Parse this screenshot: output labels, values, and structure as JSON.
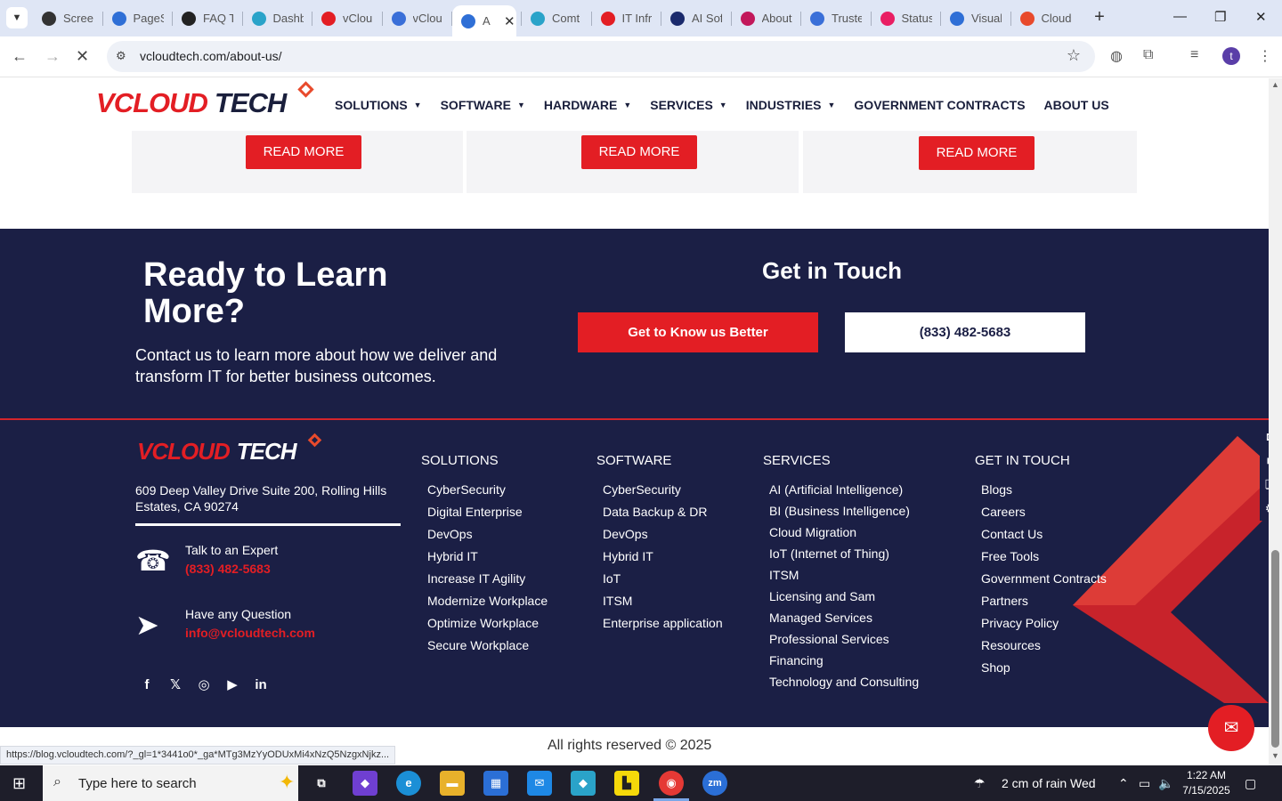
{
  "browser": {
    "tabs": [
      {
        "label": "Scree",
        "color": "#333333"
      },
      {
        "label": "PageS",
        "color": "#2f6fd6"
      },
      {
        "label": "FAQ T",
        "color": "#222222"
      },
      {
        "label": "Dashb",
        "color": "#2aa3c9"
      },
      {
        "label": "vClou",
        "color": "#e31e24"
      },
      {
        "label": "vClou",
        "color": "#3a6fd8"
      },
      {
        "label": "A",
        "color": "#2f6fd6",
        "active": true
      },
      {
        "label": "Comt",
        "color": "#2aa3c9"
      },
      {
        "label": "IT Infr",
        "color": "#e31e24"
      },
      {
        "label": "AI Sof",
        "color": "#1a2a6c"
      },
      {
        "label": "About",
        "color": "#c2185b"
      },
      {
        "label": "Truste",
        "color": "#3a6fd8"
      },
      {
        "label": "Status",
        "color": "#e91e63"
      },
      {
        "label": "Visual",
        "color": "#2f6fd6"
      },
      {
        "label": "Cloud",
        "color": "#e84a2c"
      }
    ],
    "url": "vcloudtech.com/about-us/",
    "profile_initial": "t",
    "status_url": "https://blog.vcloudtech.com/?_gl=1*3441o0*_ga*MTg3MzYyODUxMi4xNzQ5NzgxNjkz..."
  },
  "site": {
    "logo": {
      "v": "V",
      "cloud": "CLOUD",
      "tech": "TECH"
    },
    "nav": [
      {
        "label": "SOLUTIONS",
        "caret": true
      },
      {
        "label": "SOFTWARE",
        "caret": true
      },
      {
        "label": "HARDWARE",
        "caret": true
      },
      {
        "label": "SERVICES",
        "caret": true
      },
      {
        "label": "INDUSTRIES",
        "caret": true
      },
      {
        "label": "GOVERNMENT CONTRACTS",
        "caret": false
      },
      {
        "label": "ABOUT US",
        "caret": false
      }
    ],
    "cards": {
      "read_more": "READ MORE"
    },
    "cta": {
      "title": "Ready to Learn More?",
      "text": "Contact us to learn more about how we deliver and transform IT for better business outcomes.",
      "right_title": "Get in Touch",
      "btn_primary": "Get to Know us Better",
      "btn_phone": "(833) 482-5683"
    },
    "footer": {
      "address": "609 Deep Valley Drive Suite 200, Rolling Hills Estates, CA 90274",
      "expert_label": "Talk to an Expert",
      "expert_phone": "(833) 482-5683",
      "question_label": "Have any Question",
      "email": "info@vcloudtech.com",
      "social": [
        "facebook-icon",
        "x-icon",
        "instagram-icon",
        "youtube-icon",
        "linkedin-icon"
      ],
      "solutions": {
        "title": "SOLUTIONS",
        "items": [
          "CyberSecurity",
          "Digital Enterprise",
          "DevOps",
          "Hybrid IT",
          "Increase IT Agility",
          "Modernize Workplace",
          "Optimize Workplace",
          "Secure Workplace"
        ]
      },
      "software": {
        "title": "SOFTWARE",
        "items": [
          "CyberSecurity",
          "Data Backup & DR",
          "DevOps",
          "Hybrid IT",
          "IoT",
          "ITSM",
          "Enterprise application"
        ]
      },
      "services": {
        "title": "SERVICES",
        "items": [
          "AI (Artificial Intelligence)",
          "BI (Business Intelligence)",
          "Cloud Migration",
          "IoT (Internet of Thing)",
          "ITSM",
          "Licensing and Sam",
          "Managed Services",
          "Professional Services",
          "Financing",
          "Technology and Consulting"
        ]
      },
      "get_in_touch": {
        "title": "GET IN TOUCH",
        "items": [
          "Blogs",
          "Careers",
          "Contact Us",
          "Free Tools",
          "Government Contracts",
          "Partners",
          "Privacy Policy",
          "Resources",
          "Shop"
        ]
      },
      "copyright": "All rights reserved © 2025"
    }
  },
  "taskbar": {
    "search_placeholder": "Type here to search",
    "weather": "2 cm of rain Wed",
    "time": "1:22 AM",
    "date": "7/15/2025"
  },
  "colors": {
    "brand_red": "#e31e24",
    "navy": "#1b1f45"
  }
}
